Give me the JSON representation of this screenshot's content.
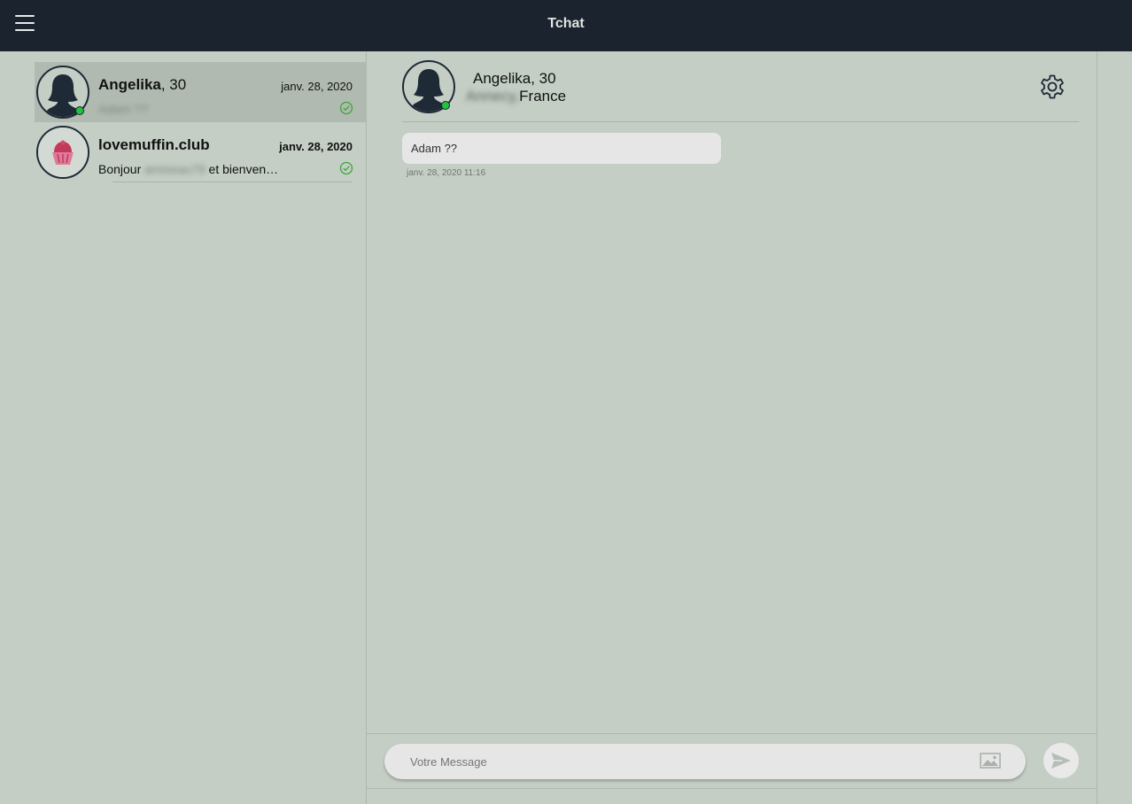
{
  "app": {
    "title": "Tchat"
  },
  "conversations": [
    {
      "name": "Angelika",
      "age_suffix": ", 30",
      "date": "janv. 28, 2020",
      "preview": "Adam ??",
      "online": true,
      "active": true
    },
    {
      "name": "lovemuffin.club",
      "date": "janv. 28, 2020",
      "preview_prefix": "Bonjour ",
      "preview_hidden": "amiseau79",
      "preview_suffix": " et bienven…",
      "online": false,
      "active": false
    }
  ],
  "chat": {
    "contact_name": "Angelika, 30",
    "location_hidden": "Annecy, ",
    "location_visible": "France",
    "messages": [
      {
        "text": "Adam ??",
        "time": "janv. 28, 2020 11:16"
      }
    ]
  },
  "composer": {
    "placeholder": "Votre Message"
  },
  "colors": {
    "topbar": "#1b232f",
    "background": "#c4cec5",
    "active_row": "#b1bab1",
    "online": "#22c33b",
    "read_check": "#3aa63a"
  },
  "icons": [
    "hamburger-icon",
    "avatar-silhouette-icon",
    "check-circle-icon",
    "gear-icon",
    "image-icon",
    "send-icon"
  ]
}
